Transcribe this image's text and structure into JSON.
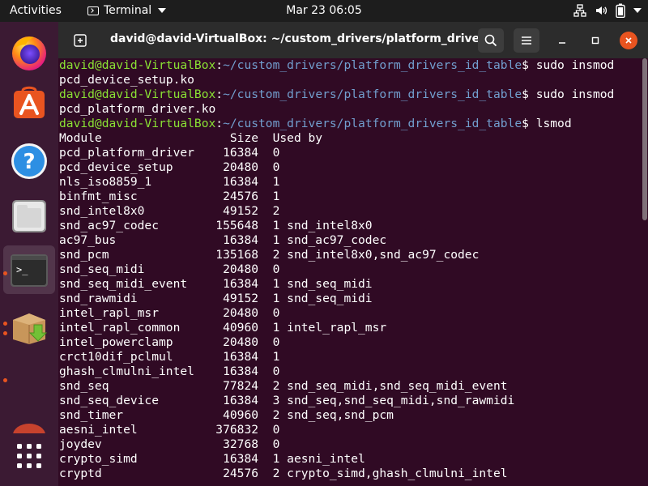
{
  "topbar": {
    "activities": "Activities",
    "app_menu": "Terminal",
    "clock": "Mar 23  06:05"
  },
  "dock": {
    "apps": [
      "firefox-icon",
      "software-center-icon",
      "help-icon",
      "files-icon",
      "terminal-icon",
      "install-package-icon",
      "app-grid-icon"
    ]
  },
  "window": {
    "title": "david@david-VirtualBox: ~/custom_drivers/platform_driver...",
    "accent": "#e95420"
  },
  "terminal": {
    "prompt_user": "david@david-VirtualBox",
    "prompt_path": "~/custom_drivers/platform_drivers_id_table",
    "commands": [
      {
        "cmd": "$ sudo insmod",
        "cont": "pcd_device_setup.ko"
      },
      {
        "cmd": "$ sudo insmod",
        "cont": "pcd_platform_driver.ko"
      },
      {
        "cmd": "$ lsmod",
        "cont": null
      }
    ],
    "lsmod_header": "Module                  Size  Used by",
    "lsmod_rows": [
      "pcd_platform_driver    16384  0",
      "pcd_device_setup       20480  0",
      "nls_iso8859_1          16384  1",
      "binfmt_misc            24576  1",
      "snd_intel8x0           49152  2",
      "snd_ac97_codec        155648  1 snd_intel8x0",
      "ac97_bus               16384  1 snd_ac97_codec",
      "snd_pcm               135168  2 snd_intel8x0,snd_ac97_codec",
      "snd_seq_midi           20480  0",
      "snd_seq_midi_event     16384  1 snd_seq_midi",
      "snd_rawmidi            49152  1 snd_seq_midi",
      "intel_rapl_msr         20480  0",
      "intel_rapl_common      40960  1 intel_rapl_msr",
      "intel_powerclamp       20480  0",
      "crct10dif_pclmul       16384  1",
      "ghash_clmulni_intel    16384  0",
      "snd_seq                77824  2 snd_seq_midi,snd_seq_midi_event",
      "snd_seq_device         16384  3 snd_seq,snd_seq_midi,snd_rawmidi",
      "snd_timer              40960  2 snd_seq,snd_pcm",
      "aesni_intel           376832  0",
      "joydev                 32768  0",
      "crypto_simd            16384  1 aesni_intel",
      "cryptd                 24576  2 crypto_simd,ghash_clmulni_intel"
    ]
  }
}
